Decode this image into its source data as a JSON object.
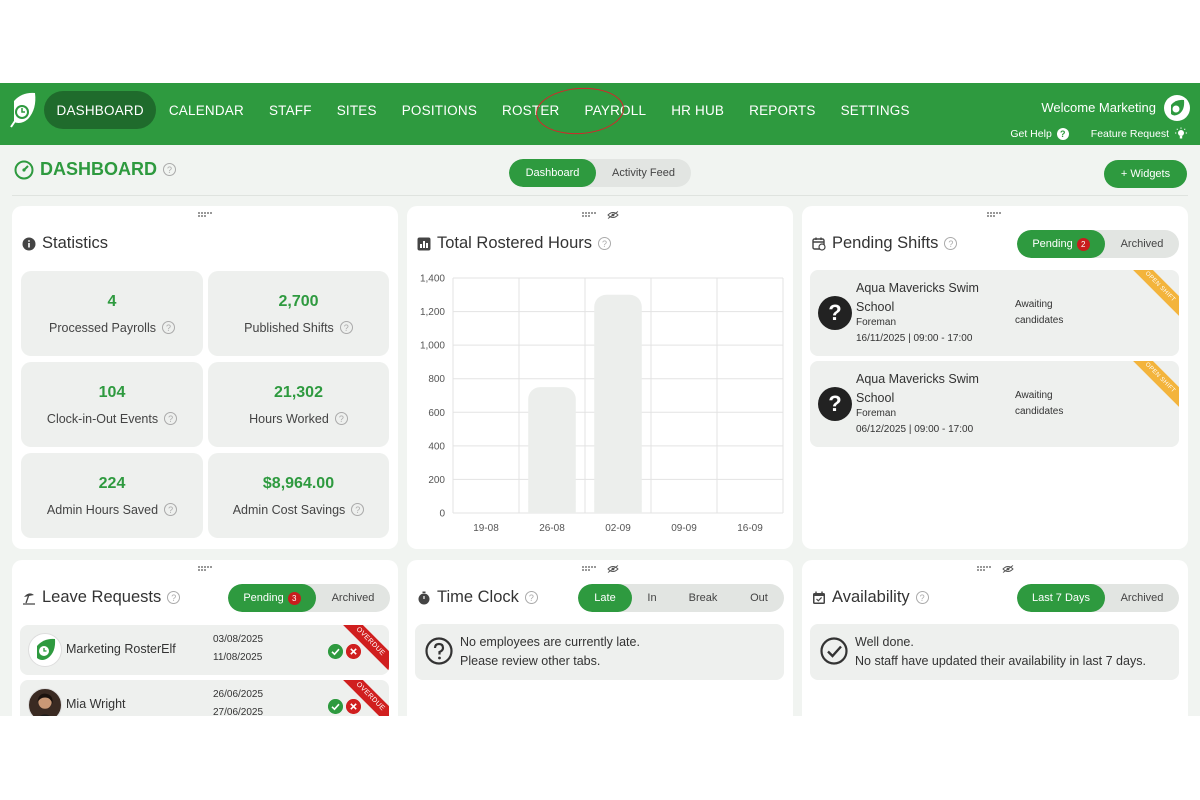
{
  "nav": {
    "items": [
      "DASHBOARD",
      "CALENDAR",
      "STAFF",
      "SITES",
      "POSITIONS",
      "ROSTER",
      "PAYROLL",
      "HR HUB",
      "REPORTS",
      "SETTINGS"
    ],
    "active": "DASHBOARD",
    "welcome": "Welcome Marketing",
    "get_help": "Get Help",
    "feature_request": "Feature Request"
  },
  "page": {
    "title": "DASHBOARD",
    "tabs": [
      "Dashboard",
      "Activity Feed"
    ],
    "active_tab": "Dashboard",
    "widgets_button": "+ Widgets"
  },
  "statistics": {
    "title": "Statistics",
    "items": [
      {
        "value": "4",
        "label": "Processed Payrolls"
      },
      {
        "value": "2,700",
        "label": "Published Shifts"
      },
      {
        "value": "104",
        "label": "Clock-in-Out Events"
      },
      {
        "value": "21,302",
        "label": "Hours Worked"
      },
      {
        "value": "224",
        "label": "Admin Hours Saved"
      },
      {
        "value": "$8,964.00",
        "label": "Admin Cost Savings"
      }
    ]
  },
  "rostered_hours": {
    "title": "Total Rostered Hours"
  },
  "chart_data": {
    "type": "bar",
    "title": "Total Rostered Hours",
    "categories": [
      "19-08",
      "26-08",
      "02-09",
      "09-09",
      "16-09"
    ],
    "values": [
      0,
      750,
      1300,
      0,
      0
    ],
    "ylim": [
      0,
      1400
    ],
    "yticks": [
      "0",
      "200",
      "400",
      "600",
      "800",
      "1,000",
      "1,200",
      "1,400"
    ],
    "grid": true
  },
  "pending_shifts": {
    "title": "Pending Shifts",
    "tabs": [
      "Pending",
      "Archived"
    ],
    "pending_count": "2",
    "items": [
      {
        "site": "Aqua Mavericks Swim School",
        "role": "Foreman",
        "datetime": "16/11/2025 | 09:00 - 17:00",
        "status": "Awaiting candidates",
        "ribbon": "OPEN SHIFT"
      },
      {
        "site": "Aqua Mavericks Swim School",
        "role": "Foreman",
        "datetime": "06/12/2025 | 09:00 - 17:00",
        "status": "Awaiting candidates",
        "ribbon": "OPEN SHIFT"
      }
    ]
  },
  "leave_requests": {
    "title": "Leave Requests",
    "tabs": [
      "Pending",
      "Archived"
    ],
    "pending_count": "3",
    "items": [
      {
        "name": "Marketing RosterElf",
        "from": "03/08/2025",
        "to": "11/08/2025",
        "ribbon": "OVERDUE"
      },
      {
        "name": "Mia Wright",
        "from": "26/06/2025",
        "to": "27/06/2025",
        "ribbon": "OVERDUE"
      }
    ]
  },
  "time_clock": {
    "title": "Time Clock",
    "tabs": [
      "Late",
      "In",
      "Break",
      "Out"
    ],
    "message_line1": "No employees are currently late.",
    "message_line2": "Please review other tabs."
  },
  "availability": {
    "title": "Availability",
    "tabs": [
      "Last 7 Days",
      "Archived"
    ],
    "message_line1": "Well done.",
    "message_line2": "No staff have updated their availability in last 7 days."
  },
  "colors": {
    "brand_green": "#2e9a3f",
    "active_nav": "#1f6b2c",
    "badge_red": "#c81d1d",
    "ribbon_orange": "#f3b43c",
    "annotation_circle": "#d2272b"
  }
}
